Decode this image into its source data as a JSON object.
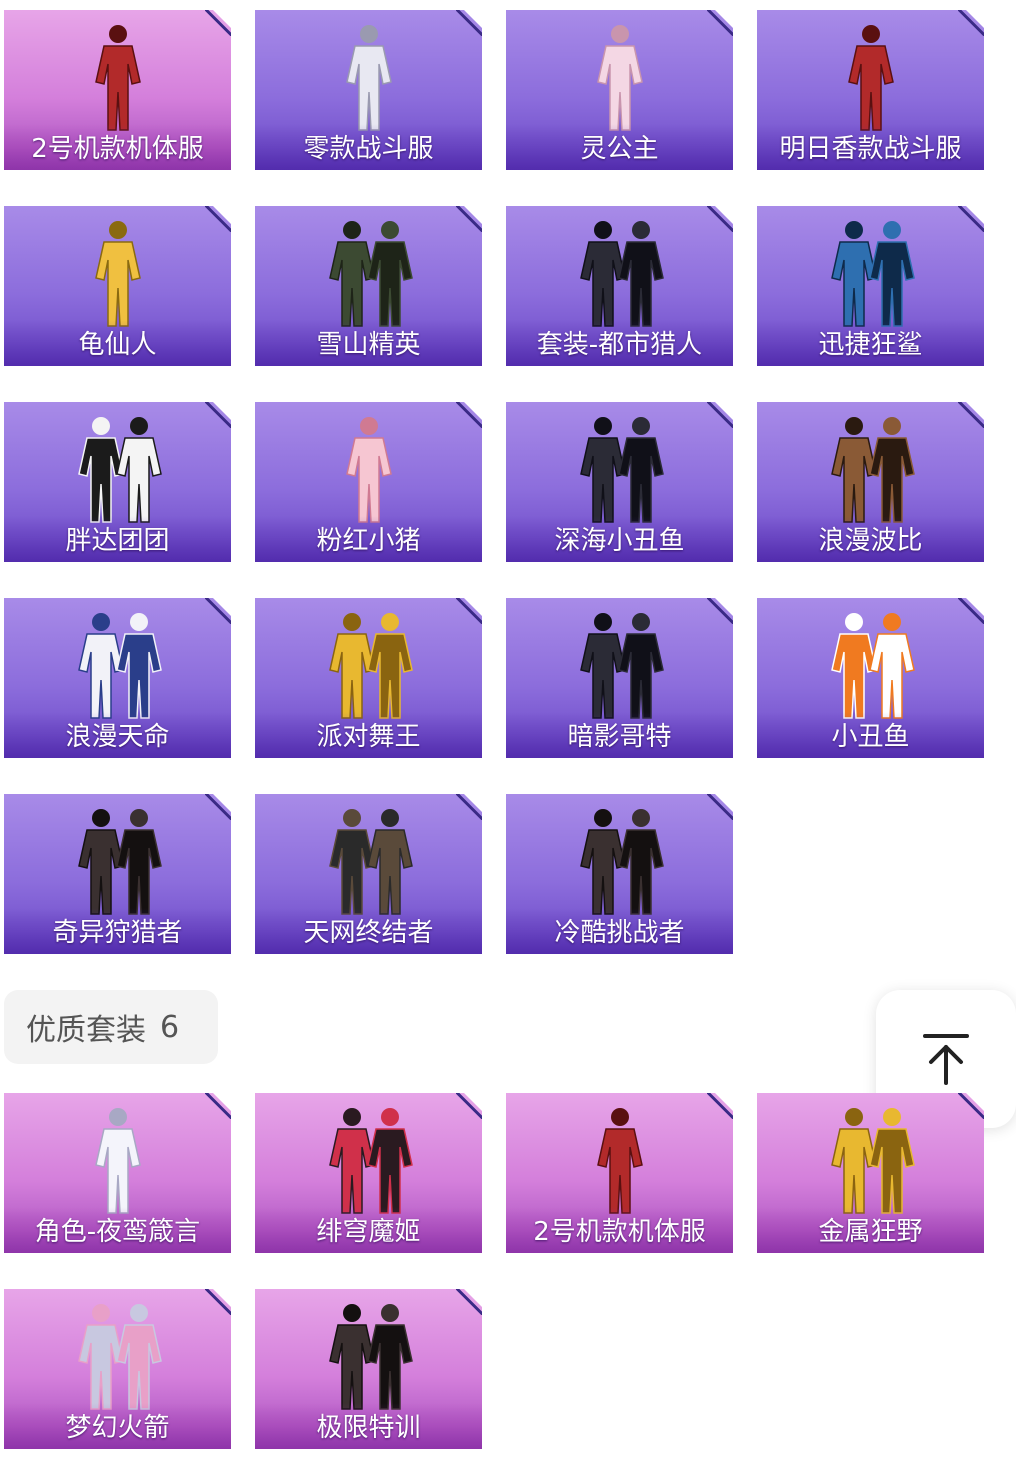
{
  "top_items": [
    {
      "name": "2号机款机体服",
      "theme": "pink",
      "figure": "red-suit"
    },
    {
      "name": "零款战斗服",
      "theme": "purple",
      "figure": "white-suit"
    },
    {
      "name": "灵公主",
      "theme": "purple",
      "figure": "dress"
    },
    {
      "name": "明日香款战斗服",
      "theme": "purple",
      "figure": "red-suit"
    },
    {
      "name": "龟仙人",
      "theme": "purple",
      "figure": "shirt"
    },
    {
      "name": "雪山精英",
      "theme": "purple",
      "figure": "coat"
    },
    {
      "name": "套装-都市猎人",
      "theme": "purple",
      "figure": "dark-outfit"
    },
    {
      "name": "迅捷狂鲨",
      "theme": "purple",
      "figure": "shark"
    },
    {
      "name": "胖达团团",
      "theme": "purple",
      "figure": "panda"
    },
    {
      "name": "粉红小猪",
      "theme": "purple",
      "figure": "pig"
    },
    {
      "name": "深海小丑鱼",
      "theme": "purple",
      "figure": "dark-outfit"
    },
    {
      "name": "浪漫波比",
      "theme": "purple",
      "figure": "bear"
    },
    {
      "name": "浪漫天命",
      "theme": "purple",
      "figure": "sport"
    },
    {
      "name": "派对舞王",
      "theme": "purple",
      "figure": "gold"
    },
    {
      "name": "暗影哥特",
      "theme": "purple",
      "figure": "dark-outfit"
    },
    {
      "name": "小丑鱼",
      "theme": "purple",
      "figure": "clownfish"
    },
    {
      "name": "奇异狩猎者",
      "theme": "purple",
      "figure": "hooded"
    },
    {
      "name": "天网终结者",
      "theme": "purple",
      "figure": "duo"
    },
    {
      "name": "冷酷挑战者",
      "theme": "purple",
      "figure": "hooded"
    }
  ],
  "section": {
    "title": "优质套装",
    "count": "6"
  },
  "bottom_items": [
    {
      "name": "角色-夜鸾箴言",
      "theme": "pink",
      "figure": "white-dress"
    },
    {
      "name": "绯穹魔姬",
      "theme": "pink",
      "figure": "redhair"
    },
    {
      "name": "2号机款机体服",
      "theme": "pink",
      "figure": "red-suit"
    },
    {
      "name": "金属狂野",
      "theme": "pink",
      "figure": "gold"
    },
    {
      "name": "梦幻火箭",
      "theme": "pink",
      "figure": "duo-silver"
    },
    {
      "name": "极限特训",
      "theme": "pink",
      "figure": "hooded"
    }
  ],
  "icons": {
    "back_to_top": "arrow-up-to-top-icon",
    "card_corner": "corner-fold-icon"
  },
  "colors": {
    "purple": "#8c6ddc",
    "pink": "#d47fdb",
    "label": "#ffffff",
    "section_bg": "#f3f3f3"
  }
}
